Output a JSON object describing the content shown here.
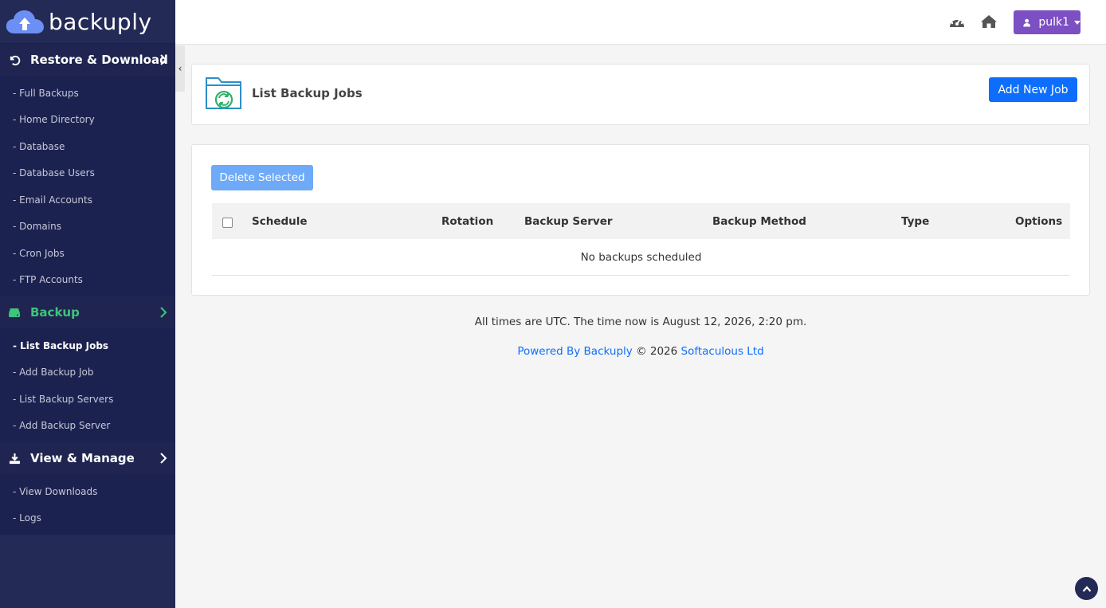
{
  "brand": {
    "name": "backuply"
  },
  "sidebar": {
    "restore": {
      "label": "Restore & Download",
      "items": [
        "- Full Backups",
        "- Home Directory",
        "- Database",
        "- Database Users",
        "- Email Accounts",
        "- Domains",
        "- Cron Jobs",
        "- FTP Accounts"
      ]
    },
    "backup": {
      "label": "Backup",
      "items": [
        "- List Backup Jobs",
        "- Add Backup Job",
        "- List Backup Servers",
        "- Add Backup Server"
      ]
    },
    "view": {
      "label": "View & Manage",
      "items": [
        "- View Downloads",
        "- Logs"
      ]
    },
    "collapse_glyph": "‹"
  },
  "topbar": {
    "icons": [
      "dashboard-icon",
      "home-icon",
      "user-icon"
    ],
    "username": "pulk1"
  },
  "main": {
    "title": "List Backup Jobs",
    "add_button": "Add New Job",
    "delete_button": "Delete Selected",
    "columns": [
      "Schedule",
      "Rotation",
      "Backup Server",
      "Backup Method",
      "Type",
      "Options"
    ],
    "empty_message": "No backups scheduled"
  },
  "footer": {
    "time_text": "All times are UTC. The time now is August 12, 2026, 2:20 pm.",
    "powered_by": "Powered By Backuply",
    "copyright": "© 2026",
    "company": "Softaculous Ltd"
  },
  "colors": {
    "sidebar_bg": "#232a56",
    "accent_green": "#3ec47b",
    "primary_blue": "#0d6efd",
    "user_purple": "#7c4fc3"
  }
}
